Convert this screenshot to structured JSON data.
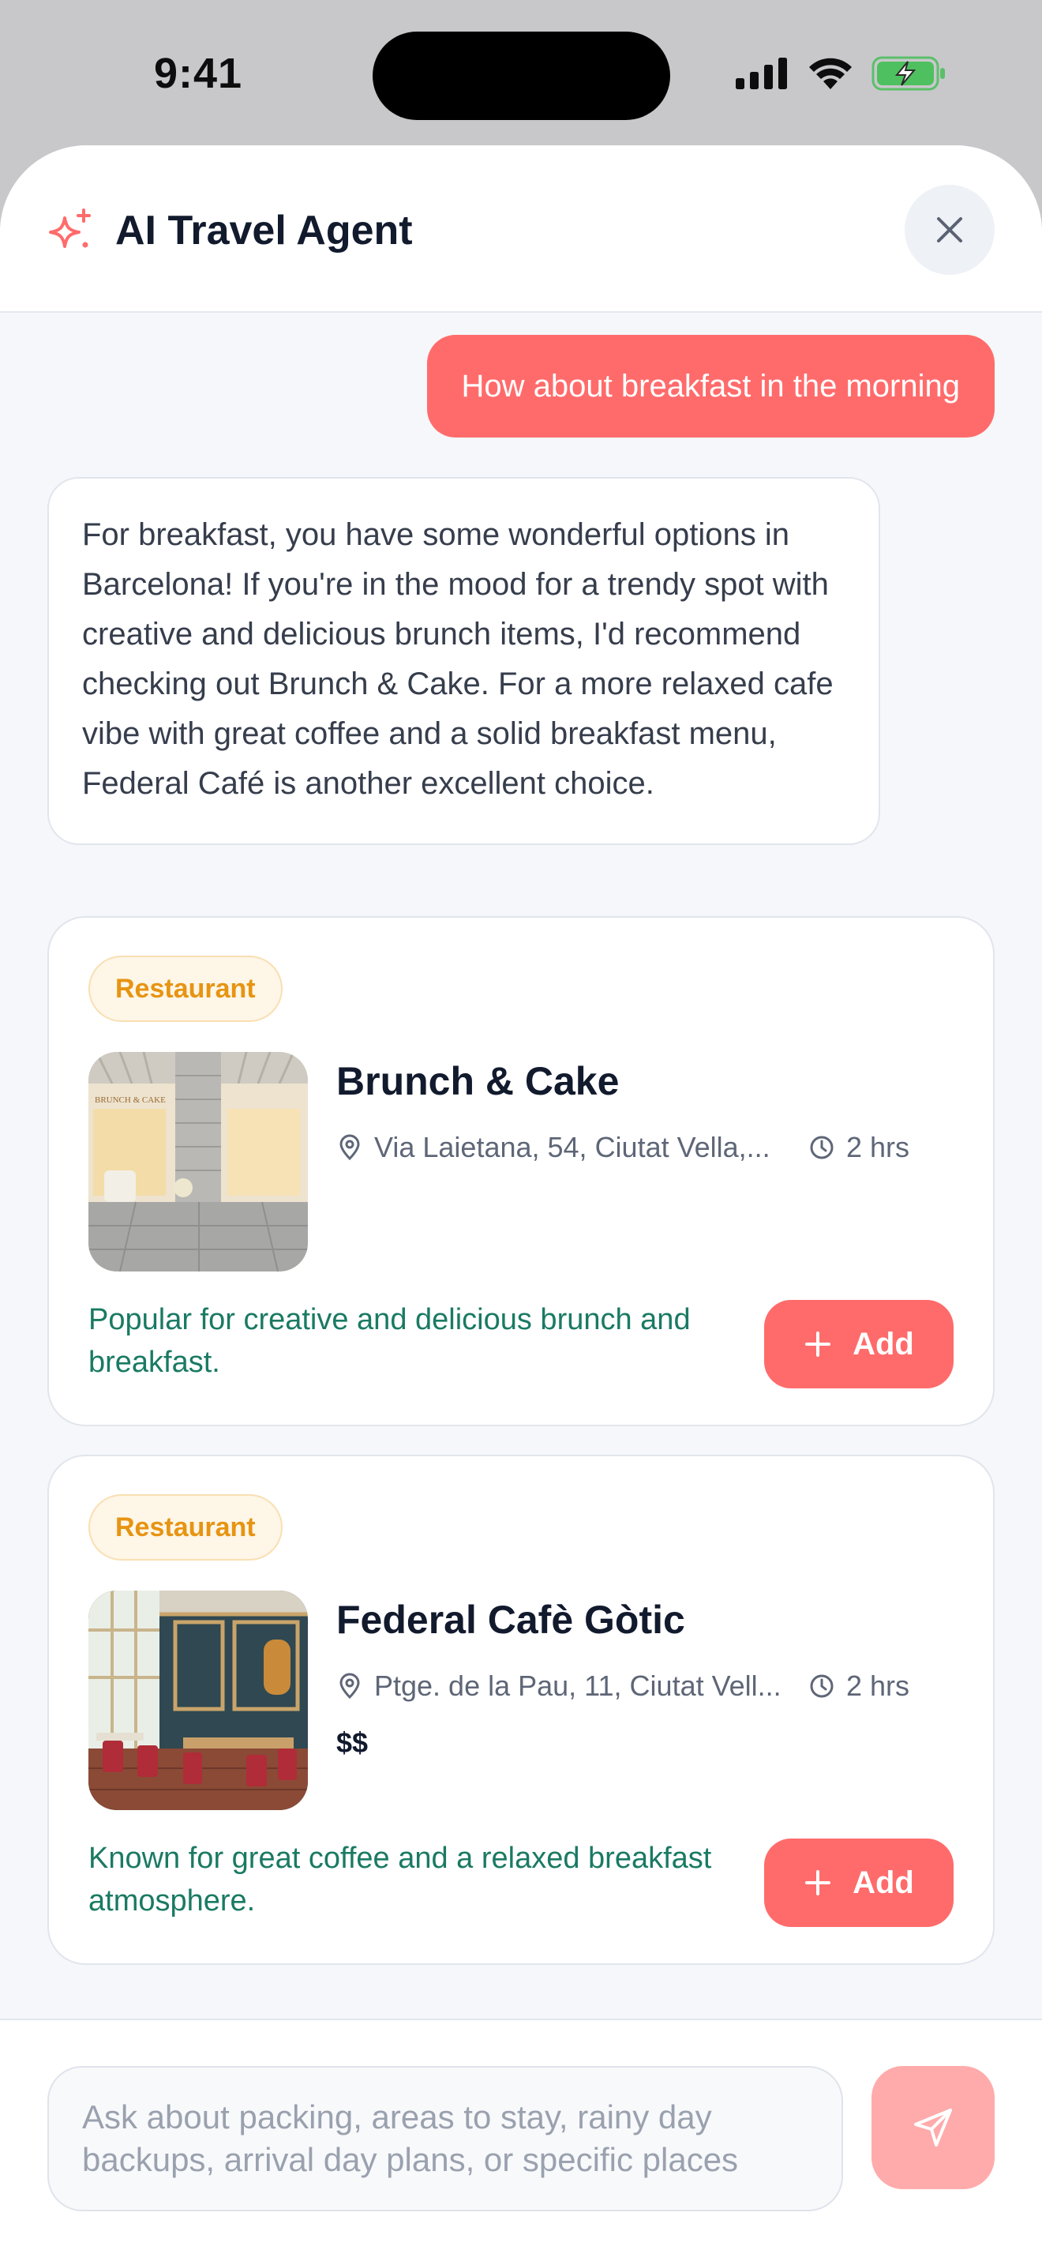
{
  "status_bar": {
    "time": "9:41"
  },
  "header": {
    "title": "AI Travel Agent",
    "icon": "sparkles-icon",
    "close_icon": "close-icon"
  },
  "conversation": {
    "user_message": "How about breakfast in the morning",
    "ai_message": "For breakfast, you have some wonderful options in Barcelona! If you're in the mood for a trendy spot with creative and delicious brunch items, I'd recommend checking out Brunch & Cake. For a more relaxed cafe vibe with great coffee and a solid breakfast menu, Federal Café is another excellent choice."
  },
  "places": [
    {
      "tag": "Restaurant",
      "name": "Brunch & Cake",
      "address": "Via Laietana, 54, Ciutat Vella,...",
      "duration": "2 hrs",
      "price": "",
      "description": "Popular for creative and delicious brunch and breakfast.",
      "add_label": "Add",
      "sign_text": "BRUNCH & CAKE"
    },
    {
      "tag": "Restaurant",
      "name": "Federal Cafè Gòtic",
      "address": "Ptge. de la Pau, 11, Ciutat Vell...",
      "duration": "2 hrs",
      "price": "$$",
      "description": "Known for great coffee and a relaxed breakfast atmosphere.",
      "add_label": "Add"
    }
  ],
  "composer": {
    "placeholder": "Ask about packing, areas to stay, rainy day backups, arrival day plans, or specific places",
    "send_icon": "send-icon"
  },
  "colors": {
    "accent": "#ff6b6b",
    "accent_disabled": "#ffabab",
    "tag_text": "#e79412",
    "description_text": "#1a7a63"
  }
}
